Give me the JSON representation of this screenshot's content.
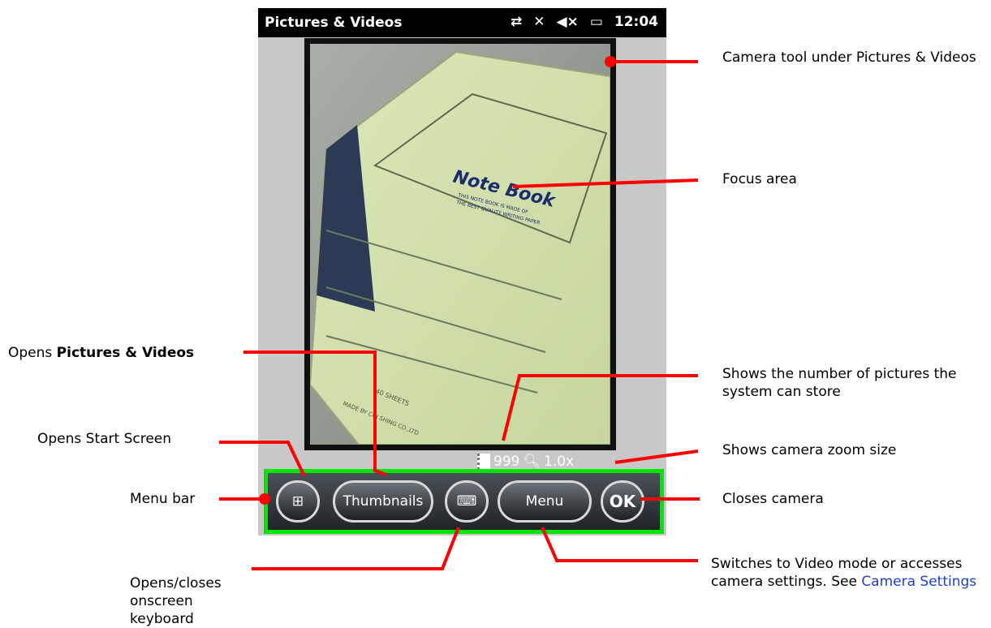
{
  "status_bar": {
    "app_title": "Pictures & Videos",
    "time": "12:04",
    "icons": [
      "connectivity-icon",
      "no-sim-icon",
      "speaker-muted-icon",
      "battery-charging-icon"
    ]
  },
  "photo": {
    "cover_title": "Note Book",
    "cover_fine_print_1": "THIS NOTE BOOK IS MADE OF",
    "cover_fine_print_2": "THE BEST QUALITY WRITING PAPER",
    "bottom_print_1": "40 SHEETS",
    "bottom_print_2": "MADE BY CHI SHING CO.,LTD"
  },
  "camera_info": {
    "remaining_count": "999",
    "zoom": "1.0x"
  },
  "menu_bar": {
    "thumbnails_label": "Thumbnails",
    "menu_label": "Menu",
    "ok_label": "OK"
  },
  "annotations": {
    "camera_tool": "Camera tool under Pictures & Videos",
    "focus_area": "Focus area",
    "opens_pictures_prefix": "Opens ",
    "opens_pictures_bold": "Pictures & Videos",
    "shows_number": "Shows the number of pictures the system can store",
    "opens_start": "Opens Start Screen",
    "shows_zoom": "Shows camera zoom size",
    "menu_bar": "Menu bar",
    "closes_camera": "Closes camera",
    "switches_text": "Switches to Video mode or accesses camera settings. See",
    "camera_settings_link": "Camera Settings",
    "opens_keyboard_1": "Opens/closes",
    "opens_keyboard_2": "onscreen keyboard"
  },
  "colors": {
    "callout": "#ff0000",
    "menubar_highlight": "#00e600",
    "link": "#1f3fd1"
  }
}
